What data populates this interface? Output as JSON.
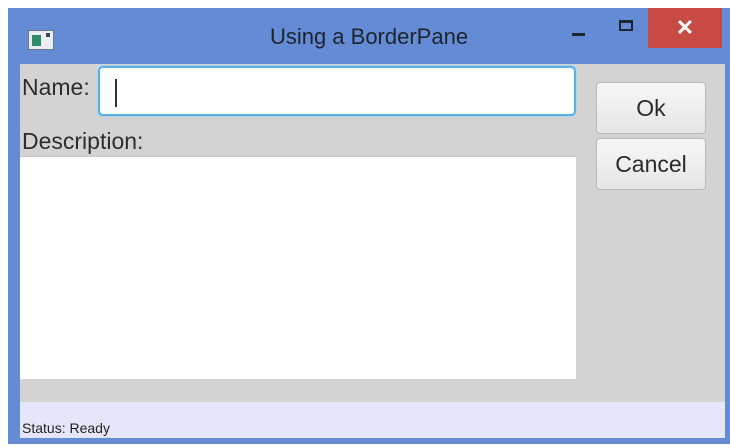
{
  "window": {
    "title": "Using a BorderPane",
    "close_label": "✕"
  },
  "form": {
    "name_label": "Name:",
    "name_value": "",
    "description_label": "Description:",
    "description_value": ""
  },
  "buttons": {
    "ok_label": "Ok",
    "cancel_label": "Cancel"
  },
  "status": {
    "text": "Status: Ready"
  },
  "colors": {
    "titlebar": "#648bd3",
    "close_button": "#c84a45",
    "client_background": "#d3d3d3",
    "status_background": "#e6e6fa",
    "focus_border": "#5bb0e4"
  },
  "icons": {
    "app": "app-icon",
    "minimize": "minimize-icon",
    "maximize": "maximize-icon",
    "close": "close-icon"
  }
}
